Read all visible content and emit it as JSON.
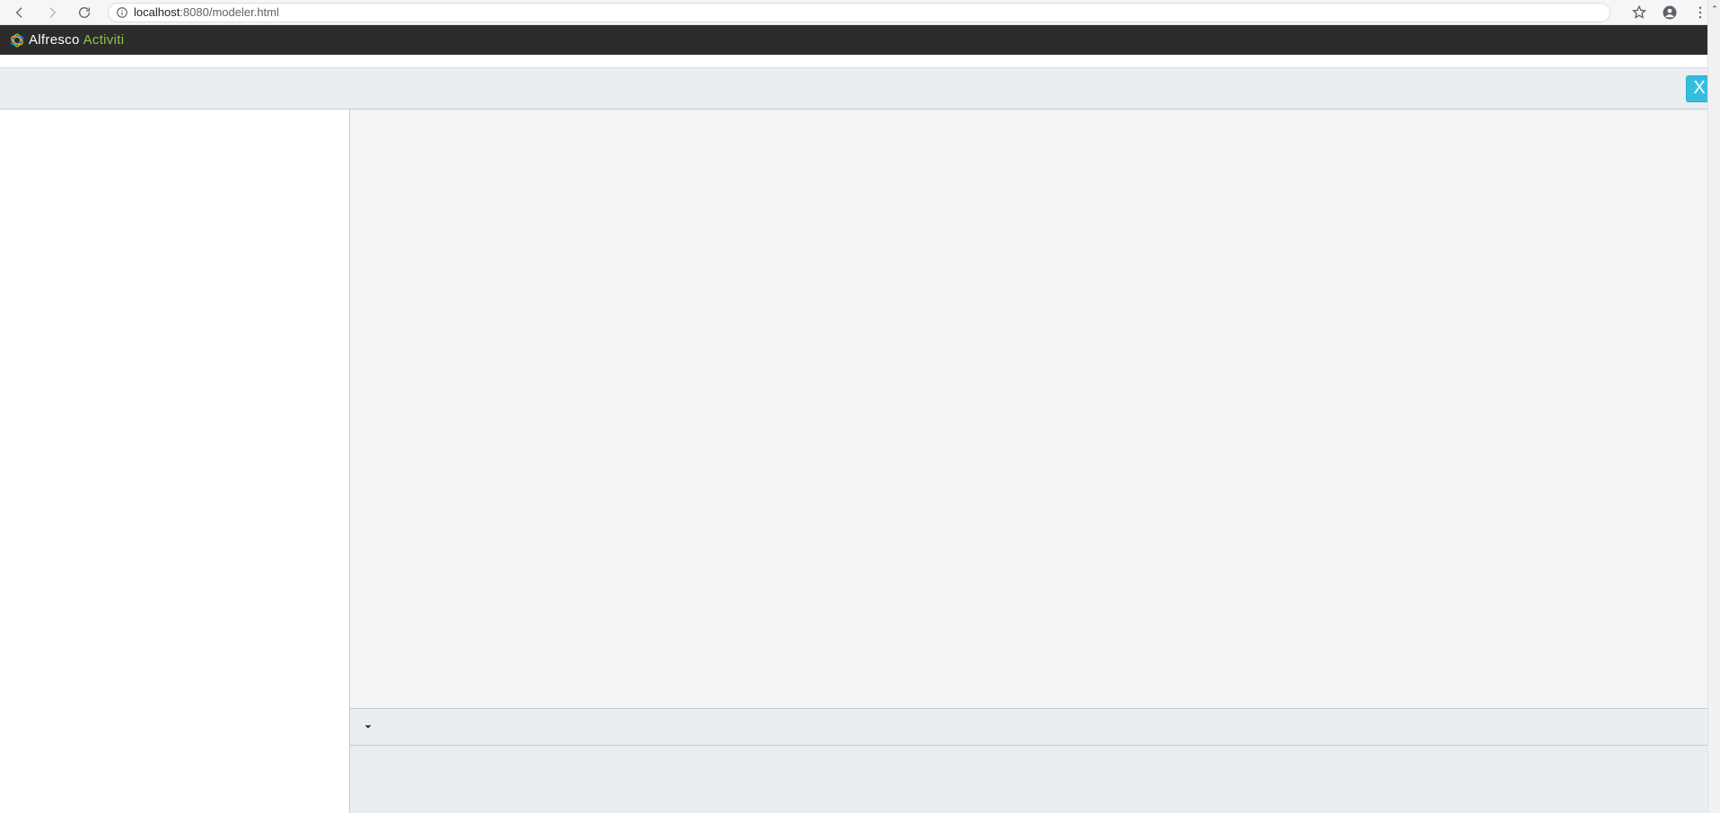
{
  "browser": {
    "url_host": "localhost",
    "url_port_path": ":8080/modeler.html"
  },
  "brand": {
    "word1": "Alfresco",
    "word2": "Activiti"
  },
  "toolbar": {
    "close_label": "X"
  }
}
